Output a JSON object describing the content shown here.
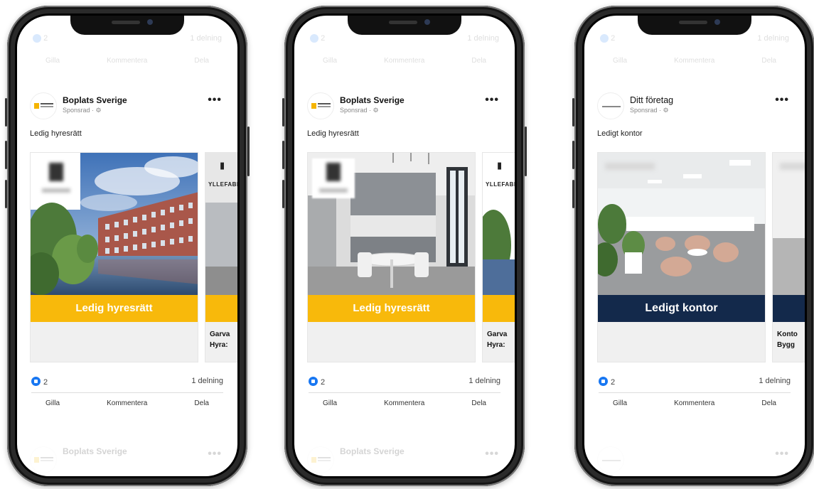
{
  "phones": [
    {
      "top": {
        "likes": "2",
        "shares": "1 delning",
        "actions": [
          "Gilla",
          "Kommentera",
          "Dela"
        ]
      },
      "page_name": "Boplats Sverige",
      "sponsored": "Sponsrad · ⚙",
      "post_text": "Ledig hyresrätt",
      "banner": "Ledig hyresrätt",
      "banner_color": "#f8b90b",
      "next_card": {
        "logo": "YLLEFABRIKEN",
        "caption_line1": "Garva",
        "caption_line2": "Hyra:"
      },
      "likes": "2",
      "shares": "1 delning",
      "actions": [
        "Gilla",
        "Kommentera",
        "Dela"
      ],
      "next_post": "Boplats Sverige"
    },
    {
      "top": {
        "likes": "2",
        "shares": "1 delning",
        "actions": [
          "Gilla",
          "Kommentera",
          "Dela"
        ]
      },
      "page_name": "Boplats Sverige",
      "sponsored": "Sponsrad · ⚙",
      "post_text": "Ledig hyresrätt",
      "banner": "Ledig hyresrätt",
      "banner_color": "#f8b90b",
      "next_card": {
        "logo": "YLLEFABRIKEN",
        "caption_line1": "Garva",
        "caption_line2": "Hyra:"
      },
      "likes": "2",
      "shares": "1 delning",
      "actions": [
        "Gilla",
        "Kommentera",
        "Dela"
      ],
      "next_post": "Boplats Sverige"
    },
    {
      "top": {
        "likes": "2",
        "shares": "1 delning",
        "actions": [
          "Gilla",
          "Kommentera",
          "Dela"
        ]
      },
      "page_name": "Ditt företag",
      "sponsored": "Sponsrad · ⚙",
      "post_text": "Ledigt kontor",
      "banner": "Ledigt kontor",
      "banner_color": "#13294b",
      "next_card": {
        "caption_line1": "Konto",
        "caption_line2": "Bygg"
      },
      "likes": "2",
      "shares": "1 delning",
      "actions": [
        "Gilla",
        "Kommentera",
        "Dela"
      ],
      "next_post": ""
    }
  ],
  "colors": {
    "facebook_blue": "#1877f2",
    "boplats_yellow": "#f8b90b",
    "office_navy": "#13294b"
  }
}
